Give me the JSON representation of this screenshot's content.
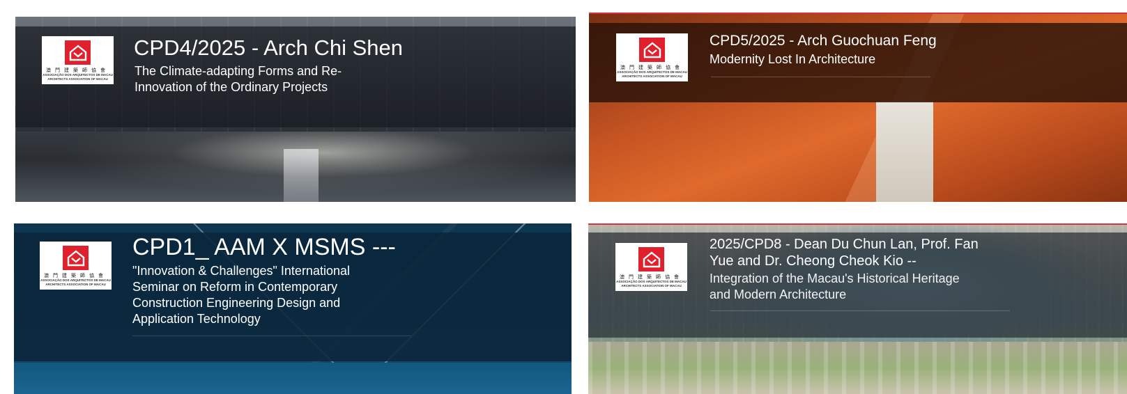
{
  "logo": {
    "chinese": "澳門建築師協會",
    "portuguese": "ASSOCIAÇÃO DOS ARQUITECTOS DE MACAU",
    "english": "ARCHITECTS ASSOCIATION OF MACAU",
    "brand_color": "#e0202c"
  },
  "cards": [
    {
      "title": "CPD4/2025 - Arch Chi Shen",
      "subtitle_lines": [
        "The Climate-adapting Forms and Re-",
        "Innovation of the Ordinary Projects"
      ]
    },
    {
      "title": "CPD5/2025 - Arch Guochuan Feng",
      "subtitle_lines": [
        "Modernity Lost In Architecture"
      ]
    },
    {
      "title": "CPD1_ AAM X MSMS ---",
      "subtitle_lines": [
        "\"Innovation & Challenges\" International",
        "Seminar on Reform in Contemporary",
        "Construction Engineering Design and",
        "Application Technology"
      ]
    },
    {
      "title_lines": [
        "2025/CPD8 - Dean Du Chun Lan, Prof. Fan",
        "Yue and Dr. Cheong Cheok Kio --"
      ],
      "subtitle_lines": [
        "Integration of the Macau's Historical Heritage",
        "and Modern Architecture"
      ]
    }
  ]
}
